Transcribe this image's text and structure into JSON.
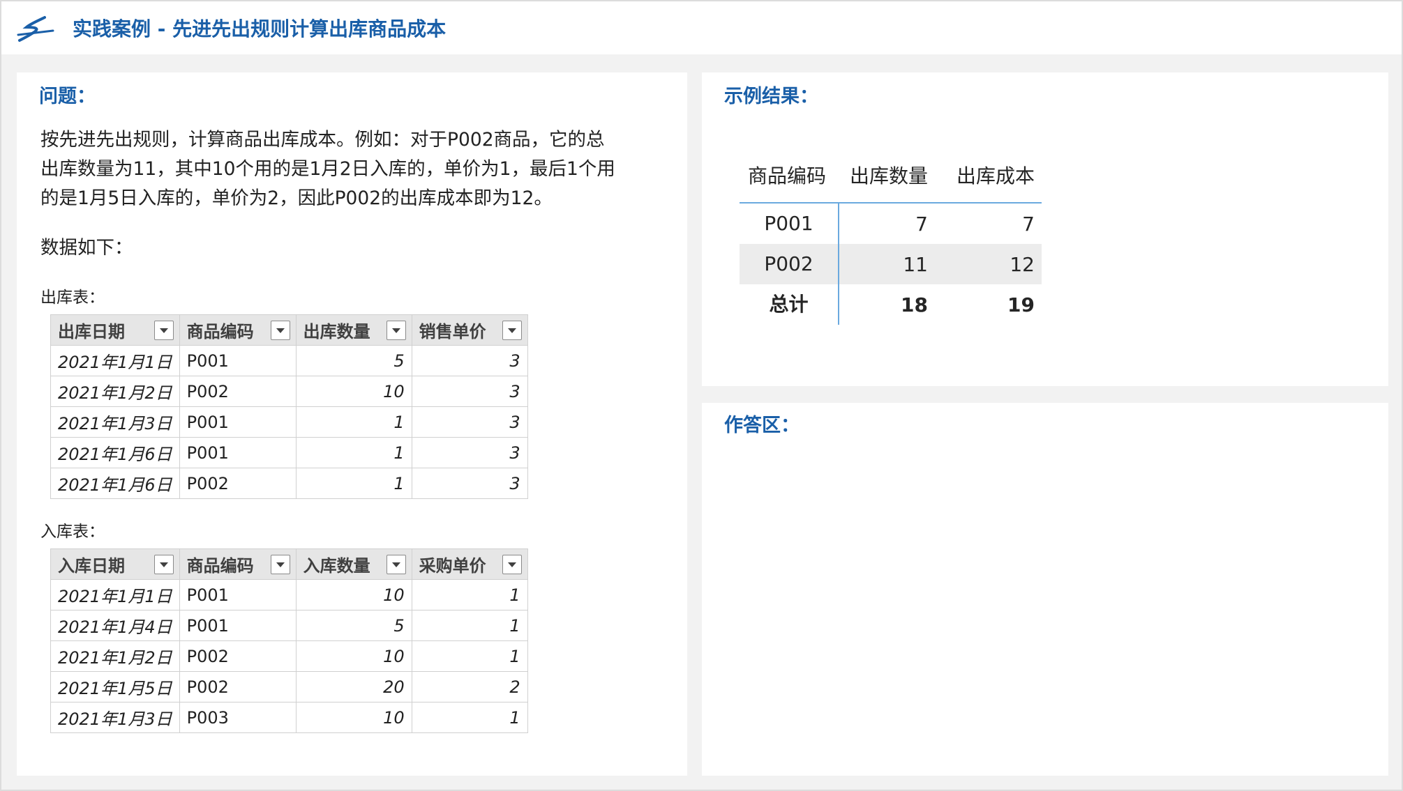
{
  "header": {
    "title": "实践案例 - 先进先出规则计算出库商品成本",
    "logo_icon": "stylized-s-logo-icon"
  },
  "question": {
    "heading": "问题：",
    "text": "按先进先出规则，计算商品出库成本。例如：对于P002商品，它的总\n出库数量为11，其中10个用的是1月2日入库的，单价为1，最后1个用\n的是1月5日入库的，单价为2，因此P002的出库成本即为12。",
    "data_intro": "数据如下："
  },
  "outbound_table": {
    "caption": "出库表：",
    "columns": [
      "出库日期",
      "商品编码",
      "出库数量",
      "销售单价"
    ],
    "rows": [
      [
        "2021年1月1日",
        "P001",
        "5",
        "3"
      ],
      [
        "2021年1月2日",
        "P002",
        "10",
        "3"
      ],
      [
        "2021年1月3日",
        "P001",
        "1",
        "3"
      ],
      [
        "2021年1月6日",
        "P001",
        "1",
        "3"
      ],
      [
        "2021年1月6日",
        "P002",
        "1",
        "3"
      ]
    ]
  },
  "inbound_table": {
    "caption": "入库表：",
    "columns": [
      "入库日期",
      "商品编码",
      "入库数量",
      "采购单价"
    ],
    "rows": [
      [
        "2021年1月1日",
        "P001",
        "10",
        "1"
      ],
      [
        "2021年1月4日",
        "P001",
        "5",
        "1"
      ],
      [
        "2021年1月2日",
        "P002",
        "10",
        "1"
      ],
      [
        "2021年1月5日",
        "P002",
        "20",
        "2"
      ],
      [
        "2021年1月3日",
        "P003",
        "10",
        "1"
      ]
    ]
  },
  "example_result": {
    "heading": "示例结果：",
    "columns": [
      "商品编码",
      "出库数量",
      "出库成本"
    ],
    "rows": [
      [
        "P001",
        "7",
        "7"
      ],
      [
        "P002",
        "11",
        "12"
      ]
    ],
    "total": [
      "总计",
      "18",
      "19"
    ]
  },
  "answer": {
    "heading": "作答区："
  },
  "colors": {
    "accent": "#1a5fa8",
    "divider": "#6aa9df",
    "table_header_bg": "#e6e6e6"
  }
}
